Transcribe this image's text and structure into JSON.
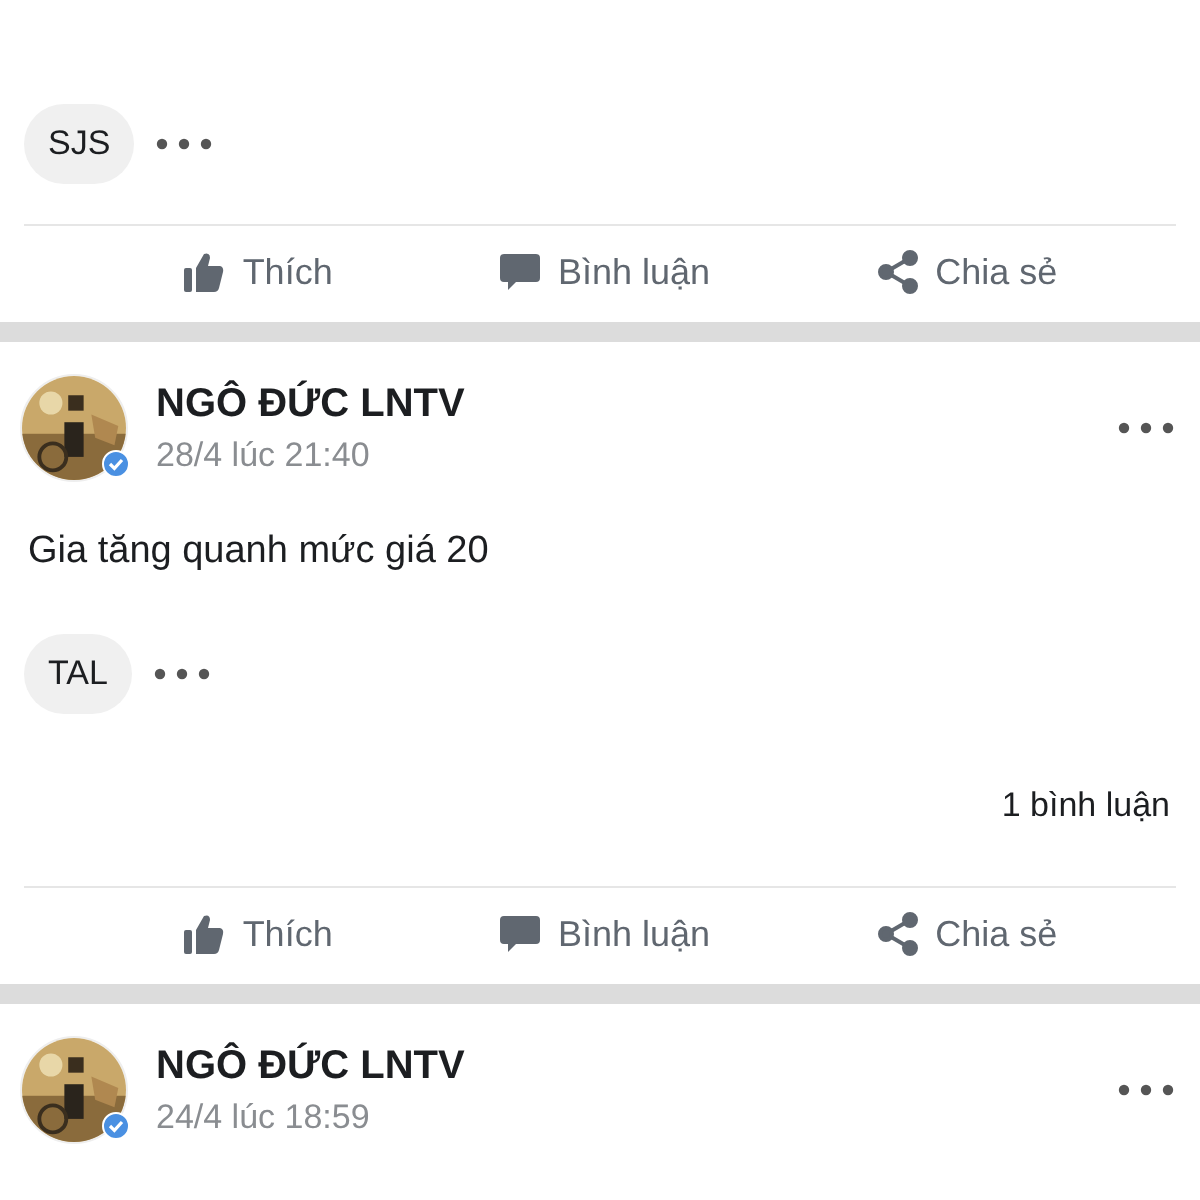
{
  "posts": [
    {
      "tag": "SJS",
      "actions": [
        {
          "kind": "like",
          "label": "Thích"
        },
        {
          "kind": "comment",
          "label": "Bình luận"
        },
        {
          "kind": "share",
          "label": "Chia sẻ"
        }
      ]
    },
    {
      "author": "NGÔ ĐỨC LNTV",
      "time": "28/4 lúc 21:40",
      "text": "Gia tăng quanh mức giá 20",
      "tag": "TAL",
      "comment_count": "1 bình luận",
      "actions": [
        {
          "kind": "like",
          "label": "Thích"
        },
        {
          "kind": "comment",
          "label": "Bình luận"
        },
        {
          "kind": "share",
          "label": "Chia sẻ"
        }
      ]
    },
    {
      "author": "NGÔ ĐỨC LNTV",
      "time": "24/4 lúc 18:59"
    }
  ]
}
